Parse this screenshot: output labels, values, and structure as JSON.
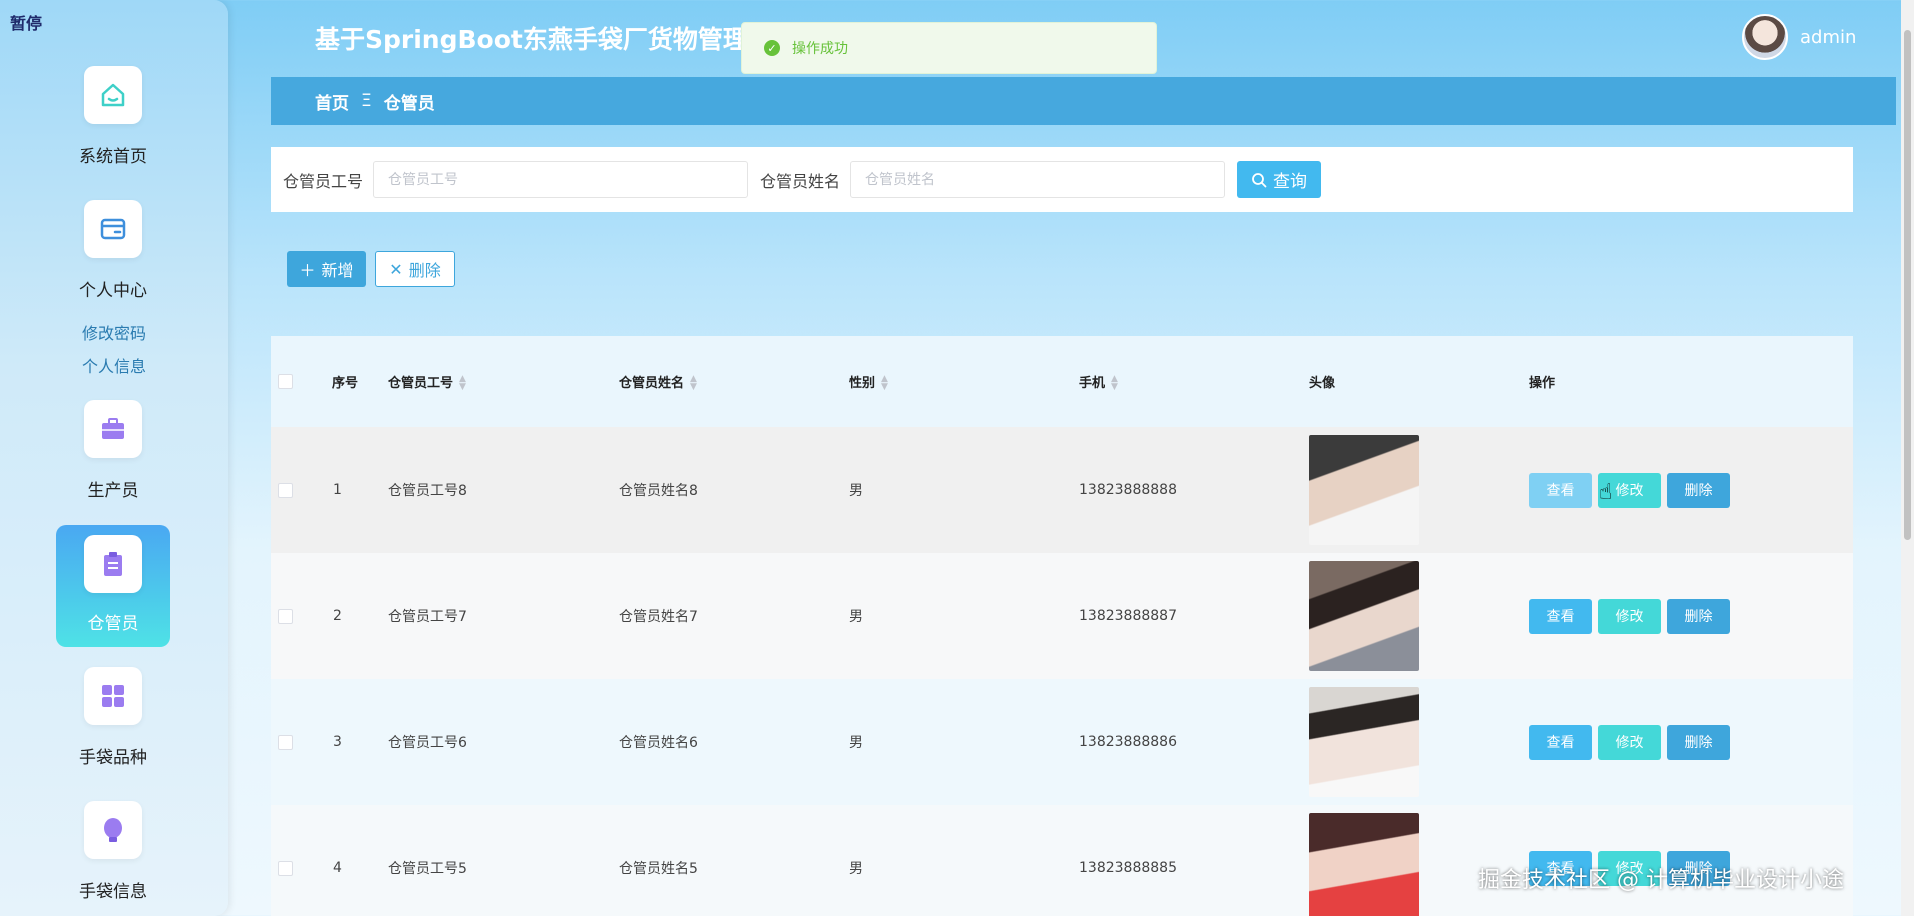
{
  "sidebar": {
    "pause_label": "暂停",
    "items": [
      {
        "label": "系统首页",
        "icon": "home-icon"
      },
      {
        "label": "个人中心",
        "icon": "wallet-icon"
      },
      {
        "label": "生产员",
        "icon": "briefcase-icon"
      },
      {
        "label": "仓管员",
        "icon": "clipboard-icon"
      },
      {
        "label": "手袋品种",
        "icon": "grid-icon"
      },
      {
        "label": "手袋信息",
        "icon": "bulb-icon"
      }
    ],
    "submenu": [
      "修改密码",
      "个人信息"
    ]
  },
  "header": {
    "title": "基于SpringBoot东燕手袋厂货物管理",
    "user_name": "admin"
  },
  "toast": {
    "message": "操作成功"
  },
  "breadcrumb": {
    "home": "首页",
    "separator": "Ξ",
    "current": "仓管员"
  },
  "search": {
    "id_label": "仓管员工号",
    "id_placeholder": "仓管员工号",
    "name_label": "仓管员姓名",
    "name_placeholder": "仓管员姓名",
    "button": "查询"
  },
  "actions": {
    "add": "新增",
    "delete": "删除"
  },
  "table": {
    "headers": [
      "序号",
      "仓管员工号",
      "仓管员姓名",
      "性别",
      "手机",
      "头像",
      "操作"
    ],
    "rows": [
      {
        "index": "1",
        "id": "仓管员工号8",
        "name": "仓管员姓名8",
        "gender": "男",
        "phone": "13823888888"
      },
      {
        "index": "2",
        "id": "仓管员工号7",
        "name": "仓管员姓名7",
        "gender": "男",
        "phone": "13823888887"
      },
      {
        "index": "3",
        "id": "仓管员工号6",
        "name": "仓管员姓名6",
        "gender": "男",
        "phone": "13823888886"
      },
      {
        "index": "4",
        "id": "仓管员工号5",
        "name": "仓管员姓名5",
        "gender": "男",
        "phone": "13823888885"
      }
    ],
    "row_buttons": {
      "view": "查看",
      "edit": "修改",
      "delete": "删除"
    }
  },
  "watermark": "掘金技术社区 @ 计算机毕业设计小途"
}
